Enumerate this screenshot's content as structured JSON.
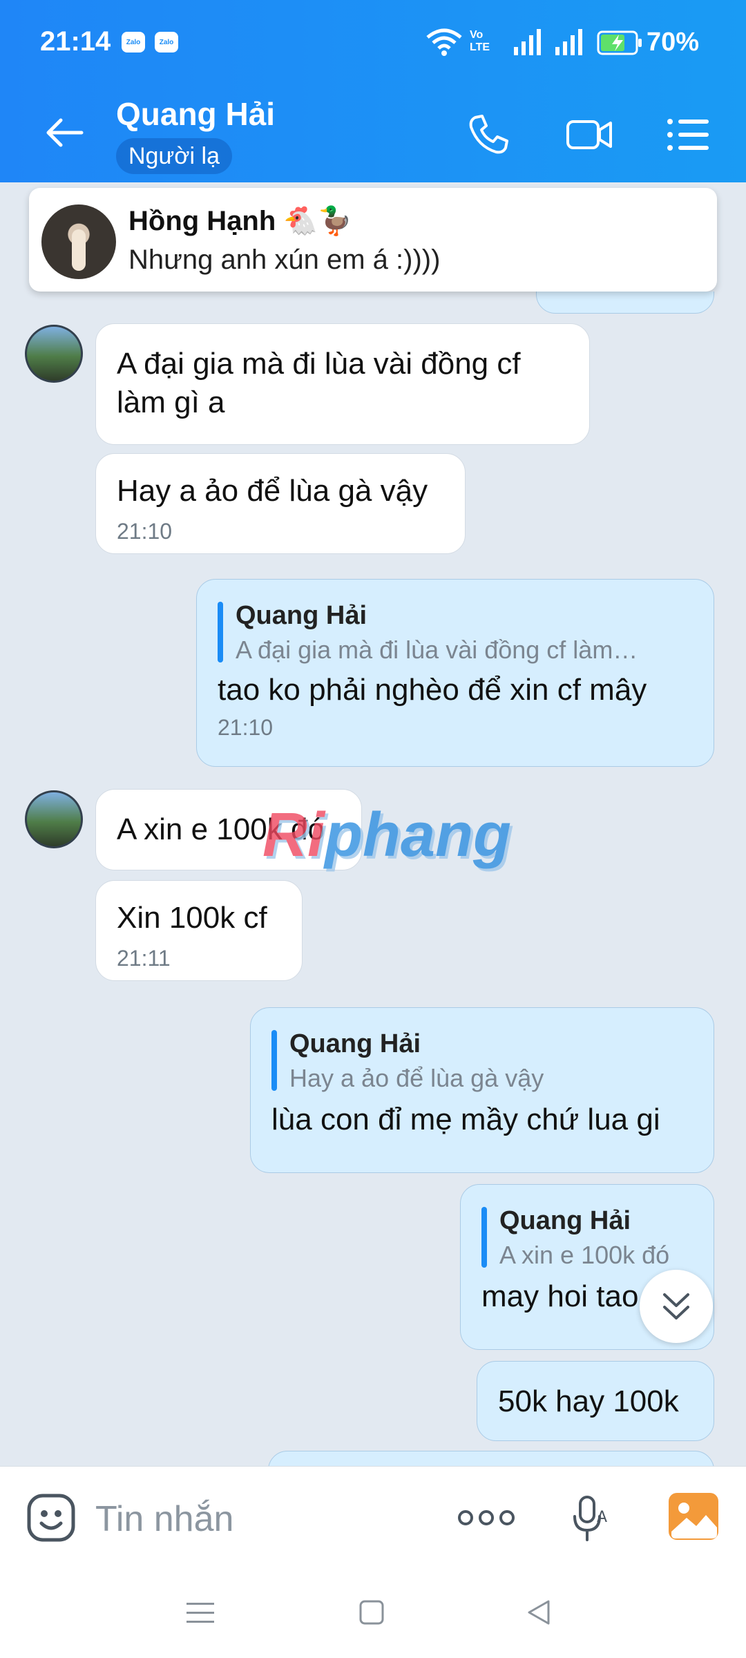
{
  "status_bar": {
    "time": "21:14",
    "notification_badges": [
      "Zalo",
      "Zalo"
    ],
    "network_label": "Vo LTE",
    "battery": "70%"
  },
  "header": {
    "contact_name": "Quang Hải",
    "stranger_badge": "Người lạ"
  },
  "pinned": {
    "name": "Hồng Hạnh 🐔🦆",
    "message": "Nhưng anh xún em á :))))"
  },
  "messages": [
    {
      "text_lines": [
        "A đại gia mà đi lùa vài đồng cf",
        "làm gì a"
      ]
    },
    {
      "text": "Hay a ảo để lùa gà vậy",
      "time": "21:10"
    },
    {
      "reply_name": "Quang Hải",
      "reply_text": "A đại gia mà đi lùa vài đồng cf làm…",
      "text": "tao ko phải nghèo để xin cf mây",
      "time": "21:10"
    },
    {
      "text": "A xin e 100k đó"
    },
    {
      "text": "Xin 100k cf",
      "time": "21:11"
    },
    {
      "reply_name": "Quang Hải",
      "reply_text": "Hay a ảo để lùa gà vậy",
      "text": "lùa con đỉ mẹ mầy chứ lua gi"
    },
    {
      "reply_name": "Quang Hải",
      "reply_text": "A xin e 100k đó",
      "text": "may hoi tao"
    },
    {
      "text": "50k hay 100k"
    }
  ],
  "watermark": {
    "part1": "Ri",
    "part2": "phang"
  },
  "input": {
    "placeholder": "Tin nhắn"
  },
  "colors": {
    "header_blue": "#1f86f7",
    "outgoing_bubble": "#d6eefe",
    "incoming_bubble": "#ffffff",
    "chat_bg": "#e2e9f1"
  }
}
